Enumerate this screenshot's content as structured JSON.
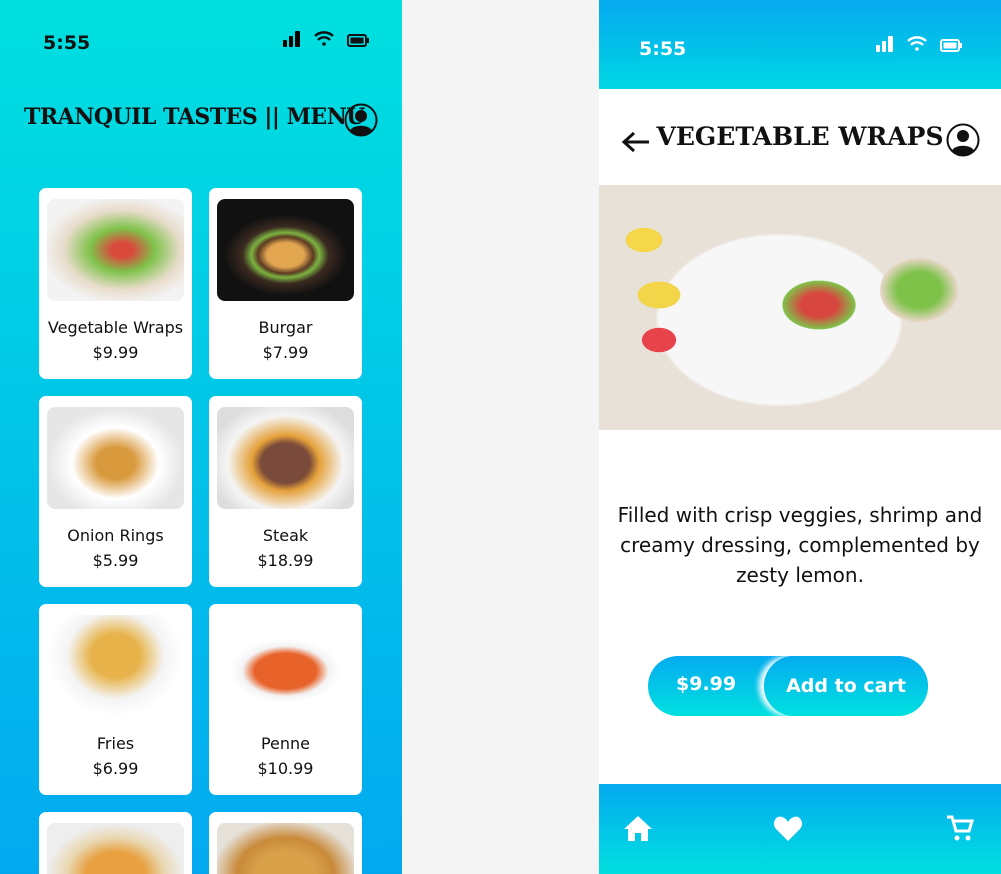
{
  "menu_screen": {
    "status": {
      "time": "5:55"
    },
    "title": "TRANQUIL TASTES || MENU",
    "items": [
      {
        "name": "Vegetable Wraps",
        "price": "$9.99"
      },
      {
        "name": "Burgar",
        "price": "$7.99"
      },
      {
        "name": "Onion Rings",
        "price": "$5.99"
      },
      {
        "name": "Steak",
        "price": "$18.99"
      },
      {
        "name": "Fries",
        "price": "$6.99"
      },
      {
        "name": "Penne",
        "price": "$10.99"
      },
      {
        "name": "",
        "price": ""
      },
      {
        "name": "",
        "price": ""
      }
    ]
  },
  "detail_screen": {
    "status": {
      "time": "5:55"
    },
    "title": "VEGETABLE WRAPS",
    "description": "Filled with crisp veggies, shrimp and creamy dressing, complemented  by zesty lemon.",
    "price": "$9.99",
    "add_to_cart": "Add to cart",
    "nav": [
      "home-icon",
      "heart-icon",
      "cart-icon"
    ]
  },
  "colors": {
    "gradient_top": "#00e0e0",
    "gradient_bottom": "#03a9f0"
  }
}
